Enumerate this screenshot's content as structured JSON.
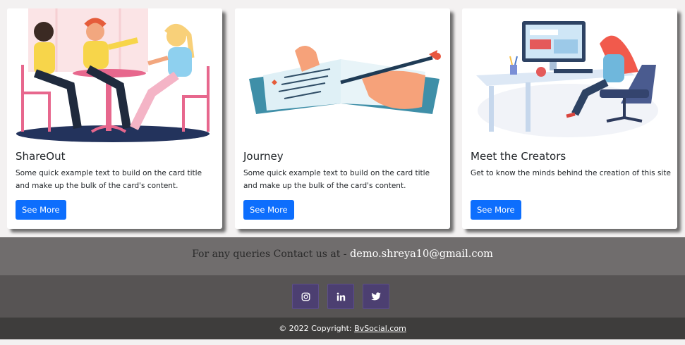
{
  "cards": [
    {
      "title": "ShareOut",
      "text": "Some quick example text to build on the card title and make up the bulk of the card's content.",
      "button": "See More",
      "image_icon": "friends-chatting-illustration"
    },
    {
      "title": "Journey",
      "text": "Some quick example text to build on the card title and make up the bulk of the card's content.",
      "button": "See More",
      "image_icon": "writing-journal-illustration"
    },
    {
      "title": "Meet the Creators",
      "text": "Get to know the minds behind the creation of this site",
      "button": "See More",
      "image_icon": "person-at-computer-illustration"
    }
  ],
  "contact": {
    "prefix": "For any queries Contact us at - ",
    "email": "demo.shreya10@gmail.com"
  },
  "social": [
    {
      "icon": "instagram-icon"
    },
    {
      "icon": "linkedin-icon"
    },
    {
      "icon": "twitter-icon"
    }
  ],
  "footer": {
    "copyright": "© 2022 Copyright: ",
    "link": "BvSocial.com"
  },
  "colors": {
    "primary_button": "#0d6efd",
    "social_button": "#4c3f71",
    "contact_bg": "#706d6d",
    "social_bg": "#575454",
    "copyright_bg": "#3e3d3c"
  }
}
